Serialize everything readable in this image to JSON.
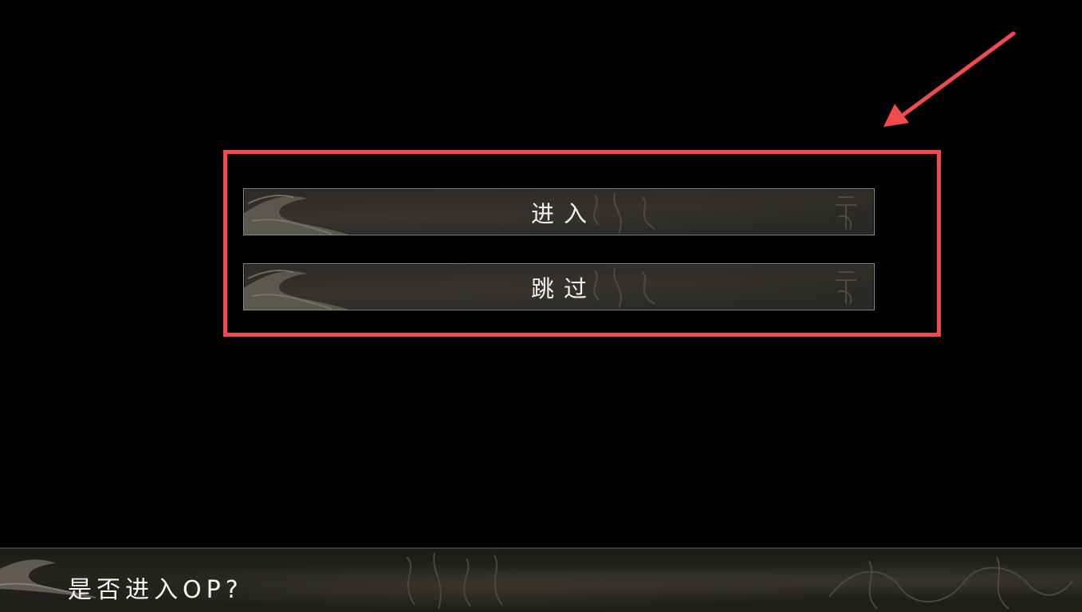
{
  "menu": {
    "enter_label": "进入",
    "skip_label": "跳过"
  },
  "dialog": {
    "prompt": "是否进入OP?"
  },
  "annotation": {
    "color": "#f24a4f"
  },
  "icons": {
    "decor": "ink-swirl-icon",
    "pointer": "arrow-icon"
  }
}
